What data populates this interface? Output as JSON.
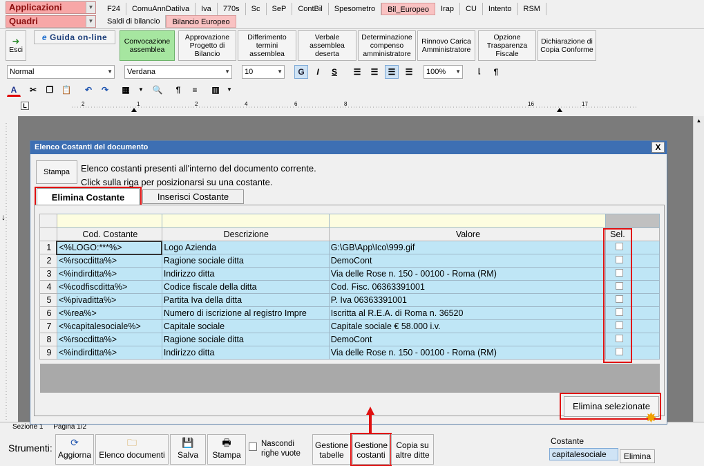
{
  "app_menu": {
    "label": "Applicazioni"
  },
  "section_menu": {
    "label": "Quadri"
  },
  "top_tabs": [
    "F24",
    "ComuAnnDatiIva",
    "Iva",
    "770s",
    "Sc",
    "SeP",
    "ContBil",
    "Spesometro",
    "Bil_Europeo",
    "Irap",
    "CU",
    "Intento",
    "RSM"
  ],
  "sub_tabs": [
    "Saldi di bilancio",
    "Bilancio Europeo"
  ],
  "toolbar": {
    "exit": "Esci",
    "guide": "Guida on-line",
    "buttons": [
      "Convocazione assemblea",
      "Approvazione Progetto di Bilancio",
      "Differimento termini assemblea",
      "Verbale assemblea deserta",
      "Determinazione compenso amministratore",
      "Rinnovo Carica Amministratore",
      "Opzione Trasparenza Fiscale",
      "Dichiarazione di Copia Conforme"
    ]
  },
  "format": {
    "style": "Normal",
    "font": "Verdana",
    "size": "10",
    "zoom": "100%"
  },
  "dialog": {
    "title": "Elenco Costanti del documento",
    "close": "X",
    "print": "Stampa",
    "info_line1": "Elenco costanti presenti all'interno del documento corrente.",
    "info_line2": "Click sulla riga per posizionarsi su una costante.",
    "tab_delete": "Elimina Costante",
    "tab_insert": "Inserisci Costante",
    "headers": [
      "Cod. Costante",
      "Descrizione",
      "Valore",
      "Sel."
    ],
    "rows": [
      {
        "n": "1",
        "code": "<%LOGO:***%>",
        "desc": "Logo Azienda",
        "value": "G:\\GB\\App\\Ico\\999.gif"
      },
      {
        "n": "2",
        "code": "<%rsocditta%>",
        "desc": "Ragione sociale ditta",
        "value": " DemoCont"
      },
      {
        "n": "3",
        "code": "<%indirditta%>",
        "desc": "Indirizzo ditta",
        "value": "Via delle Rose n. 150 - 00100 - Roma (RM)"
      },
      {
        "n": "4",
        "code": "<%codfiscditta%>",
        "desc": "Codice fiscale della ditta",
        "value": "Cod. Fisc. 06363391001"
      },
      {
        "n": "5",
        "code": "<%pivaditta%>",
        "desc": "Partita Iva della ditta",
        "value": "P. Iva 06363391001"
      },
      {
        "n": "6",
        "code": "<%rea%>",
        "desc": "Numero di iscrizione al registro Impre",
        "value": "Iscritta al R.E.A. di Roma n. 36520"
      },
      {
        "n": "7",
        "code": "<%capitalesociale%>",
        "desc": "Capitale sociale",
        "value": "Capitale sociale € 58.000 i.v."
      },
      {
        "n": "8",
        "code": "<%rsocditta%>",
        "desc": "Ragione sociale ditta",
        "value": " DemoCont"
      },
      {
        "n": "9",
        "code": "<%indirditta%>",
        "desc": "Indirizzo ditta",
        "value": "Via delle Rose n. 150 - 00100 - Roma (RM)"
      }
    ],
    "delete_selected": "Elimina selezionate"
  },
  "status_bar": [
    "Sezione 1",
    "Pagina 1/2"
  ],
  "tools": {
    "label": "Strumenti:",
    "refresh": "Aggiorna",
    "doc_list": "Elenco documenti",
    "save": "Salva",
    "print": "Stampa",
    "hide_empty": "Nascondi righe vuote",
    "manage_tables": "Gestione tabelle",
    "manage_constants": "Gestione costanti",
    "copy_other": "Copia su altre ditte"
  },
  "constant_panel": {
    "label": "Costante",
    "value": "capitalesociale",
    "delete": "Elimina"
  }
}
